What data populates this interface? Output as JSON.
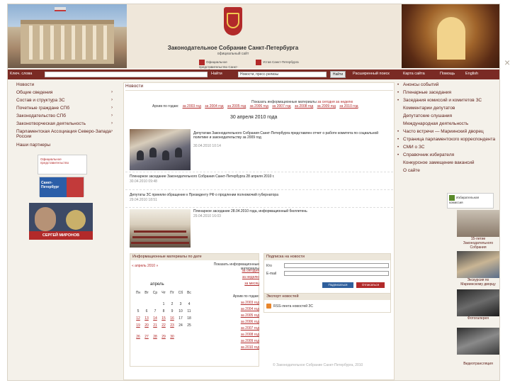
{
  "header": {
    "title": "Законодательное Собрание Санкт-Петербурга",
    "subtitle": "официальный сайт",
    "link1": "Официальное представительство Санкт-Петербурга",
    "link2": "Устав Санкт-Петербурга"
  },
  "nav": {
    "search_label": "Ключ. слова",
    "search_placeholder": "",
    "find": "Найти",
    "select_value": "Новости, пресс-релизы",
    "go": "Найти",
    "advanced": "Расширенный поиск",
    "sitemap": "Карта сайта",
    "help": "Помощь",
    "english": "English"
  },
  "left_menu": [
    {
      "label": "Новости",
      "arrow": ""
    },
    {
      "label": "Общие сведения",
      "arrow": "›"
    },
    {
      "label": "Состав и структура ЗС",
      "arrow": "›"
    },
    {
      "label": "Почетные граждане СПб",
      "arrow": "›"
    },
    {
      "label": "Законодательство СПб",
      "arrow": "›"
    },
    {
      "label": "Законотворческая деятельность",
      "arrow": "›"
    },
    {
      "label": "Парламентская Ассоциация Северо-Запада России",
      "arrow": "›"
    },
    {
      "label": "Наши партнеры",
      "arrow": ""
    }
  ],
  "left_banners": {
    "banner1": "Официальное представительство",
    "flag_text": "Санкт-Петербург",
    "person_name": "СЕРГЕЙ МИРОНОВ"
  },
  "center": {
    "heading": "Новости",
    "show_info": "Показать информационные материалы",
    "show_all": "за сегодня",
    "show_all2": "за неделю",
    "archive_label": "Архив по годам:",
    "archive_years": [
      "за 2003 год",
      "за 2004 год",
      "за 2005 год",
      "за 2006 год",
      "за 2007 год",
      "за 2008 год",
      "за 2009 год",
      "за 2010 год"
    ],
    "date_heading": "30 апреля 2010 года",
    "news": [
      {
        "text": "Депутатам Законодательного Собрания Санкт-Петербурга представлен отчет о работе комитета по социальной политике и законодательству за 2009 год",
        "date": "30.04.2010 10:14"
      },
      {
        "text": "Пленарное заседание Законодательного Собрания Санкт-Петербурга 28 апреля 2010 г.",
        "date": "30.04.2010 09:48"
      },
      {
        "text": "Депутаты ЗС приняли обращение к Президенту РФ о продлении полномочий губернатора",
        "date": "29.04.2010 18:51"
      },
      {
        "text": "Пленарное заседание 28.04.2010 года, информационный бюллетень",
        "date": "29.04.2010 16:03"
      }
    ],
    "info_box_title": "Информационные материалы по дате",
    "cal_nav": "« апрель 2010 »",
    "month": "апрель",
    "weekdays": [
      "Пн",
      "Вт",
      "Ср",
      "Чт",
      "Пт",
      "Сб",
      "Вс"
    ],
    "days": [
      "",
      "",
      "",
      "1",
      "2",
      "3",
      "4",
      "5",
      "6",
      "7",
      "8",
      "9",
      "10",
      "11",
      "12",
      "13",
      "14",
      "15",
      "16",
      "17",
      "18",
      "19",
      "20",
      "21",
      "22",
      "23",
      "24",
      "25",
      "26",
      "27",
      "28",
      "29",
      "30",
      "",
      ""
    ],
    "info_right": [
      "Показать информационные материалы",
      "за сегодня",
      "за неделю",
      "за месяц",
      "",
      "Архив по годам:",
      "за 2003 год",
      "за 2004 год",
      "за 2005 год",
      "за 2006 год",
      "за 2007 год",
      "за 2008 год",
      "за 2009 год",
      "за 2010 год"
    ],
    "subscribe_title": "Подписка на новости",
    "sub_who": "Кто",
    "sub_email": "E-mail",
    "btn_subscribe": "Подписаться",
    "btn_unsubscribe": "Отписаться",
    "export_title": "Экспорт новостей",
    "rss": "RSS-лента новостей ЗС",
    "footer": "© Законодательное Собрание Санкт-Петербурга, 2010"
  },
  "right_menu": [
    "Анонсы событий",
    "Пленарные заседания",
    "Заседания комиссий и комитетов ЗС",
    "Комментарии депутатов",
    "Депутатские слушания",
    "Международная деятельность",
    "Часто встречи — Мариинский дворец",
    "Страница парламентского корреспондента",
    "СМИ о ЗС",
    "Справочник избирателя",
    "Конкурсное замещение вакансий",
    "О сайте"
  ],
  "right_widget": "Избирательная комиссия",
  "thumbs": [
    {
      "label": "15-летие Законодательного Собрания"
    },
    {
      "label": "Экскурсия по Мариинскому дворцу"
    },
    {
      "label": "Фотогалерея"
    },
    {
      "label": "Видеотрансляция"
    }
  ]
}
